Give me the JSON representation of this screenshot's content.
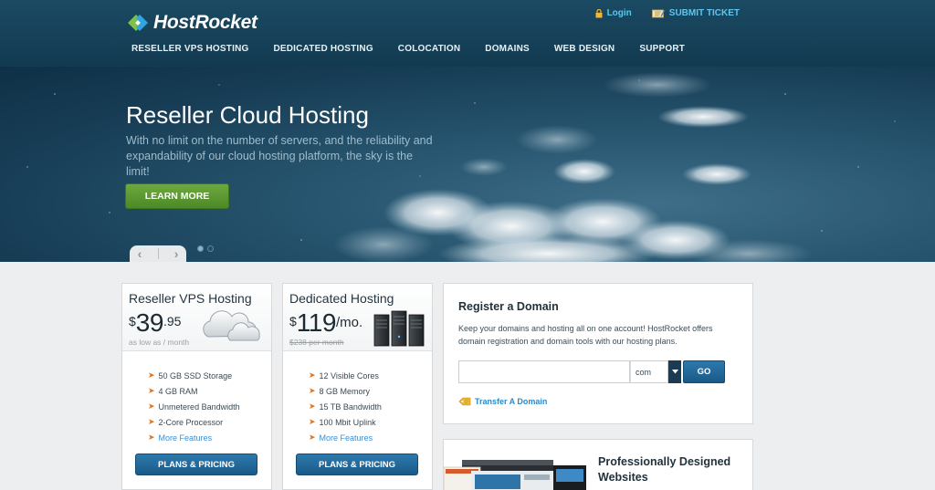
{
  "brand": {
    "name": "HostRocket"
  },
  "top_links": {
    "login": "Login",
    "submit_ticket": "SUBMIT TICKET"
  },
  "nav": [
    "RESELLER VPS HOSTING",
    "DEDICATED HOSTING",
    "COLOCATION",
    "DOMAINS",
    "WEB DESIGN",
    "SUPPORT"
  ],
  "hero": {
    "title": "Reseller Cloud Hosting",
    "subtitle": "With no limit on the number of servers, and the reliability and expandability of our cloud hosting platform, the sky is the limit!",
    "button": "LEARN MORE",
    "slides_total": 2,
    "active_slide": 1
  },
  "plans": [
    {
      "title": "Reseller VPS Hosting",
      "currency": "$",
      "price": "39",
      "cents": ".95",
      "per": "",
      "note": "as low as / month",
      "note_strike": false,
      "features": [
        "50 GB SSD Storage",
        "4 GB RAM",
        "Unmetered Bandwidth",
        "2-Core Processor"
      ],
      "more": "More Features",
      "button": "PLANS & PRICING",
      "icon": "cloud-icon"
    },
    {
      "title": "Dedicated Hosting",
      "currency": "$",
      "price": "119",
      "cents": "",
      "per": "/mo.",
      "note": "$238 per month",
      "note_strike": true,
      "features": [
        "12 Visible Cores",
        "8 GB Memory",
        "15 TB Bandwidth",
        "100 Mbit Uplink"
      ],
      "more": "More Features",
      "button": "PLANS & PRICING",
      "icon": "servers-icon"
    }
  ],
  "domain": {
    "title": "Register a Domain",
    "description": "Keep your domains and hosting all on one account! HostRocket offers domain registration and domain tools with our hosting plans.",
    "input_value": "",
    "tld": "com",
    "go": "GO",
    "transfer": "Transfer A Domain"
  },
  "design": {
    "title": "Professionally Designed Websites"
  },
  "colors": {
    "accent_blue": "#2d79ad",
    "accent_green": "#5c9b33",
    "link": "#3c8ed0",
    "header": "#173f56"
  }
}
